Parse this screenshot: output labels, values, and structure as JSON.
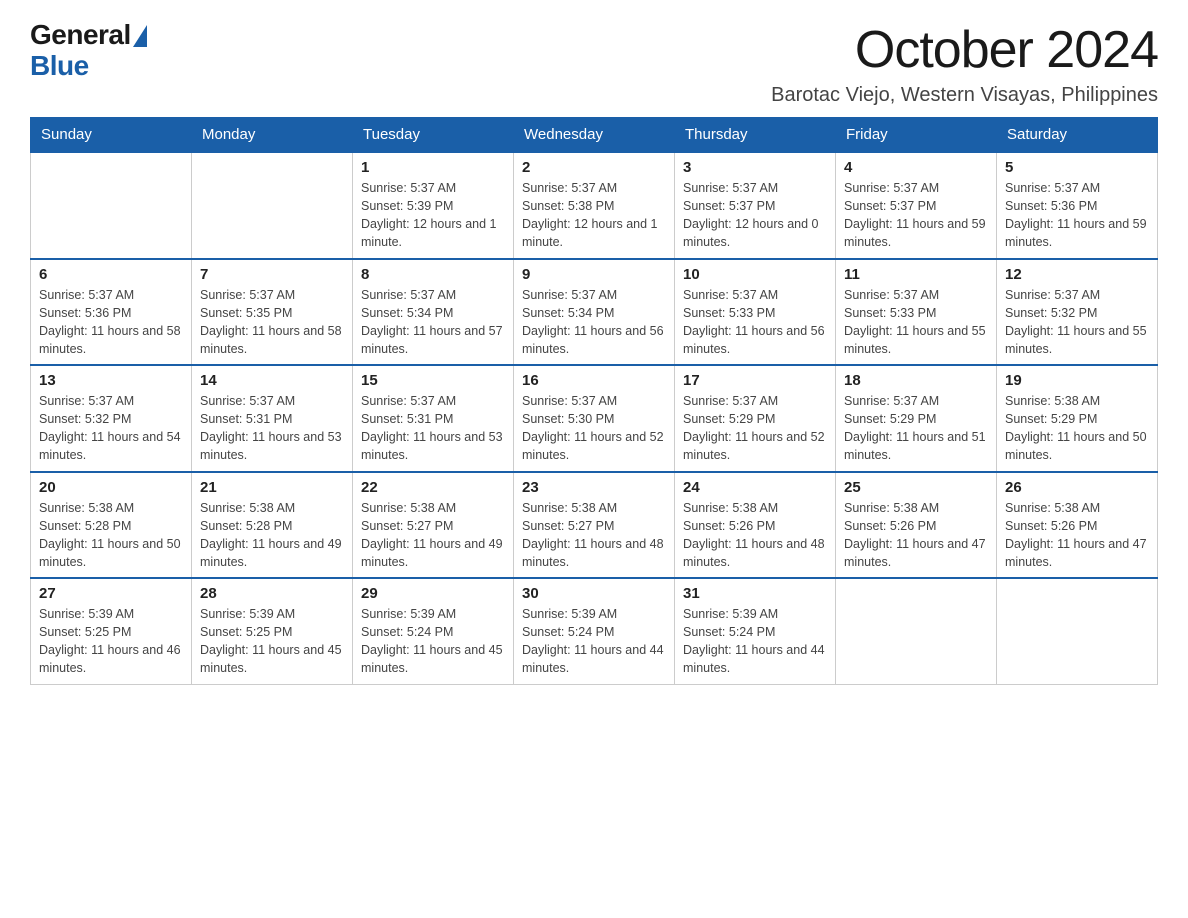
{
  "header": {
    "logo_general": "General",
    "logo_blue": "Blue",
    "month_title": "October 2024",
    "location": "Barotac Viejo, Western Visayas, Philippines"
  },
  "columns": [
    "Sunday",
    "Monday",
    "Tuesday",
    "Wednesday",
    "Thursday",
    "Friday",
    "Saturday"
  ],
  "weeks": [
    [
      {
        "day": "",
        "sunrise": "",
        "sunset": "",
        "daylight": ""
      },
      {
        "day": "",
        "sunrise": "",
        "sunset": "",
        "daylight": ""
      },
      {
        "day": "1",
        "sunrise": "Sunrise: 5:37 AM",
        "sunset": "Sunset: 5:39 PM",
        "daylight": "Daylight: 12 hours and 1 minute."
      },
      {
        "day": "2",
        "sunrise": "Sunrise: 5:37 AM",
        "sunset": "Sunset: 5:38 PM",
        "daylight": "Daylight: 12 hours and 1 minute."
      },
      {
        "day": "3",
        "sunrise": "Sunrise: 5:37 AM",
        "sunset": "Sunset: 5:37 PM",
        "daylight": "Daylight: 12 hours and 0 minutes."
      },
      {
        "day": "4",
        "sunrise": "Sunrise: 5:37 AM",
        "sunset": "Sunset: 5:37 PM",
        "daylight": "Daylight: 11 hours and 59 minutes."
      },
      {
        "day": "5",
        "sunrise": "Sunrise: 5:37 AM",
        "sunset": "Sunset: 5:36 PM",
        "daylight": "Daylight: 11 hours and 59 minutes."
      }
    ],
    [
      {
        "day": "6",
        "sunrise": "Sunrise: 5:37 AM",
        "sunset": "Sunset: 5:36 PM",
        "daylight": "Daylight: 11 hours and 58 minutes."
      },
      {
        "day": "7",
        "sunrise": "Sunrise: 5:37 AM",
        "sunset": "Sunset: 5:35 PM",
        "daylight": "Daylight: 11 hours and 58 minutes."
      },
      {
        "day": "8",
        "sunrise": "Sunrise: 5:37 AM",
        "sunset": "Sunset: 5:34 PM",
        "daylight": "Daylight: 11 hours and 57 minutes."
      },
      {
        "day": "9",
        "sunrise": "Sunrise: 5:37 AM",
        "sunset": "Sunset: 5:34 PM",
        "daylight": "Daylight: 11 hours and 56 minutes."
      },
      {
        "day": "10",
        "sunrise": "Sunrise: 5:37 AM",
        "sunset": "Sunset: 5:33 PM",
        "daylight": "Daylight: 11 hours and 56 minutes."
      },
      {
        "day": "11",
        "sunrise": "Sunrise: 5:37 AM",
        "sunset": "Sunset: 5:33 PM",
        "daylight": "Daylight: 11 hours and 55 minutes."
      },
      {
        "day": "12",
        "sunrise": "Sunrise: 5:37 AM",
        "sunset": "Sunset: 5:32 PM",
        "daylight": "Daylight: 11 hours and 55 minutes."
      }
    ],
    [
      {
        "day": "13",
        "sunrise": "Sunrise: 5:37 AM",
        "sunset": "Sunset: 5:32 PM",
        "daylight": "Daylight: 11 hours and 54 minutes."
      },
      {
        "day": "14",
        "sunrise": "Sunrise: 5:37 AM",
        "sunset": "Sunset: 5:31 PM",
        "daylight": "Daylight: 11 hours and 53 minutes."
      },
      {
        "day": "15",
        "sunrise": "Sunrise: 5:37 AM",
        "sunset": "Sunset: 5:31 PM",
        "daylight": "Daylight: 11 hours and 53 minutes."
      },
      {
        "day": "16",
        "sunrise": "Sunrise: 5:37 AM",
        "sunset": "Sunset: 5:30 PM",
        "daylight": "Daylight: 11 hours and 52 minutes."
      },
      {
        "day": "17",
        "sunrise": "Sunrise: 5:37 AM",
        "sunset": "Sunset: 5:29 PM",
        "daylight": "Daylight: 11 hours and 52 minutes."
      },
      {
        "day": "18",
        "sunrise": "Sunrise: 5:37 AM",
        "sunset": "Sunset: 5:29 PM",
        "daylight": "Daylight: 11 hours and 51 minutes."
      },
      {
        "day": "19",
        "sunrise": "Sunrise: 5:38 AM",
        "sunset": "Sunset: 5:29 PM",
        "daylight": "Daylight: 11 hours and 50 minutes."
      }
    ],
    [
      {
        "day": "20",
        "sunrise": "Sunrise: 5:38 AM",
        "sunset": "Sunset: 5:28 PM",
        "daylight": "Daylight: 11 hours and 50 minutes."
      },
      {
        "day": "21",
        "sunrise": "Sunrise: 5:38 AM",
        "sunset": "Sunset: 5:28 PM",
        "daylight": "Daylight: 11 hours and 49 minutes."
      },
      {
        "day": "22",
        "sunrise": "Sunrise: 5:38 AM",
        "sunset": "Sunset: 5:27 PM",
        "daylight": "Daylight: 11 hours and 49 minutes."
      },
      {
        "day": "23",
        "sunrise": "Sunrise: 5:38 AM",
        "sunset": "Sunset: 5:27 PM",
        "daylight": "Daylight: 11 hours and 48 minutes."
      },
      {
        "day": "24",
        "sunrise": "Sunrise: 5:38 AM",
        "sunset": "Sunset: 5:26 PM",
        "daylight": "Daylight: 11 hours and 48 minutes."
      },
      {
        "day": "25",
        "sunrise": "Sunrise: 5:38 AM",
        "sunset": "Sunset: 5:26 PM",
        "daylight": "Daylight: 11 hours and 47 minutes."
      },
      {
        "day": "26",
        "sunrise": "Sunrise: 5:38 AM",
        "sunset": "Sunset: 5:26 PM",
        "daylight": "Daylight: 11 hours and 47 minutes."
      }
    ],
    [
      {
        "day": "27",
        "sunrise": "Sunrise: 5:39 AM",
        "sunset": "Sunset: 5:25 PM",
        "daylight": "Daylight: 11 hours and 46 minutes."
      },
      {
        "day": "28",
        "sunrise": "Sunrise: 5:39 AM",
        "sunset": "Sunset: 5:25 PM",
        "daylight": "Daylight: 11 hours and 45 minutes."
      },
      {
        "day": "29",
        "sunrise": "Sunrise: 5:39 AM",
        "sunset": "Sunset: 5:24 PM",
        "daylight": "Daylight: 11 hours and 45 minutes."
      },
      {
        "day": "30",
        "sunrise": "Sunrise: 5:39 AM",
        "sunset": "Sunset: 5:24 PM",
        "daylight": "Daylight: 11 hours and 44 minutes."
      },
      {
        "day": "31",
        "sunrise": "Sunrise: 5:39 AM",
        "sunset": "Sunset: 5:24 PM",
        "daylight": "Daylight: 11 hours and 44 minutes."
      },
      {
        "day": "",
        "sunrise": "",
        "sunset": "",
        "daylight": ""
      },
      {
        "day": "",
        "sunrise": "",
        "sunset": "",
        "daylight": ""
      }
    ]
  ]
}
